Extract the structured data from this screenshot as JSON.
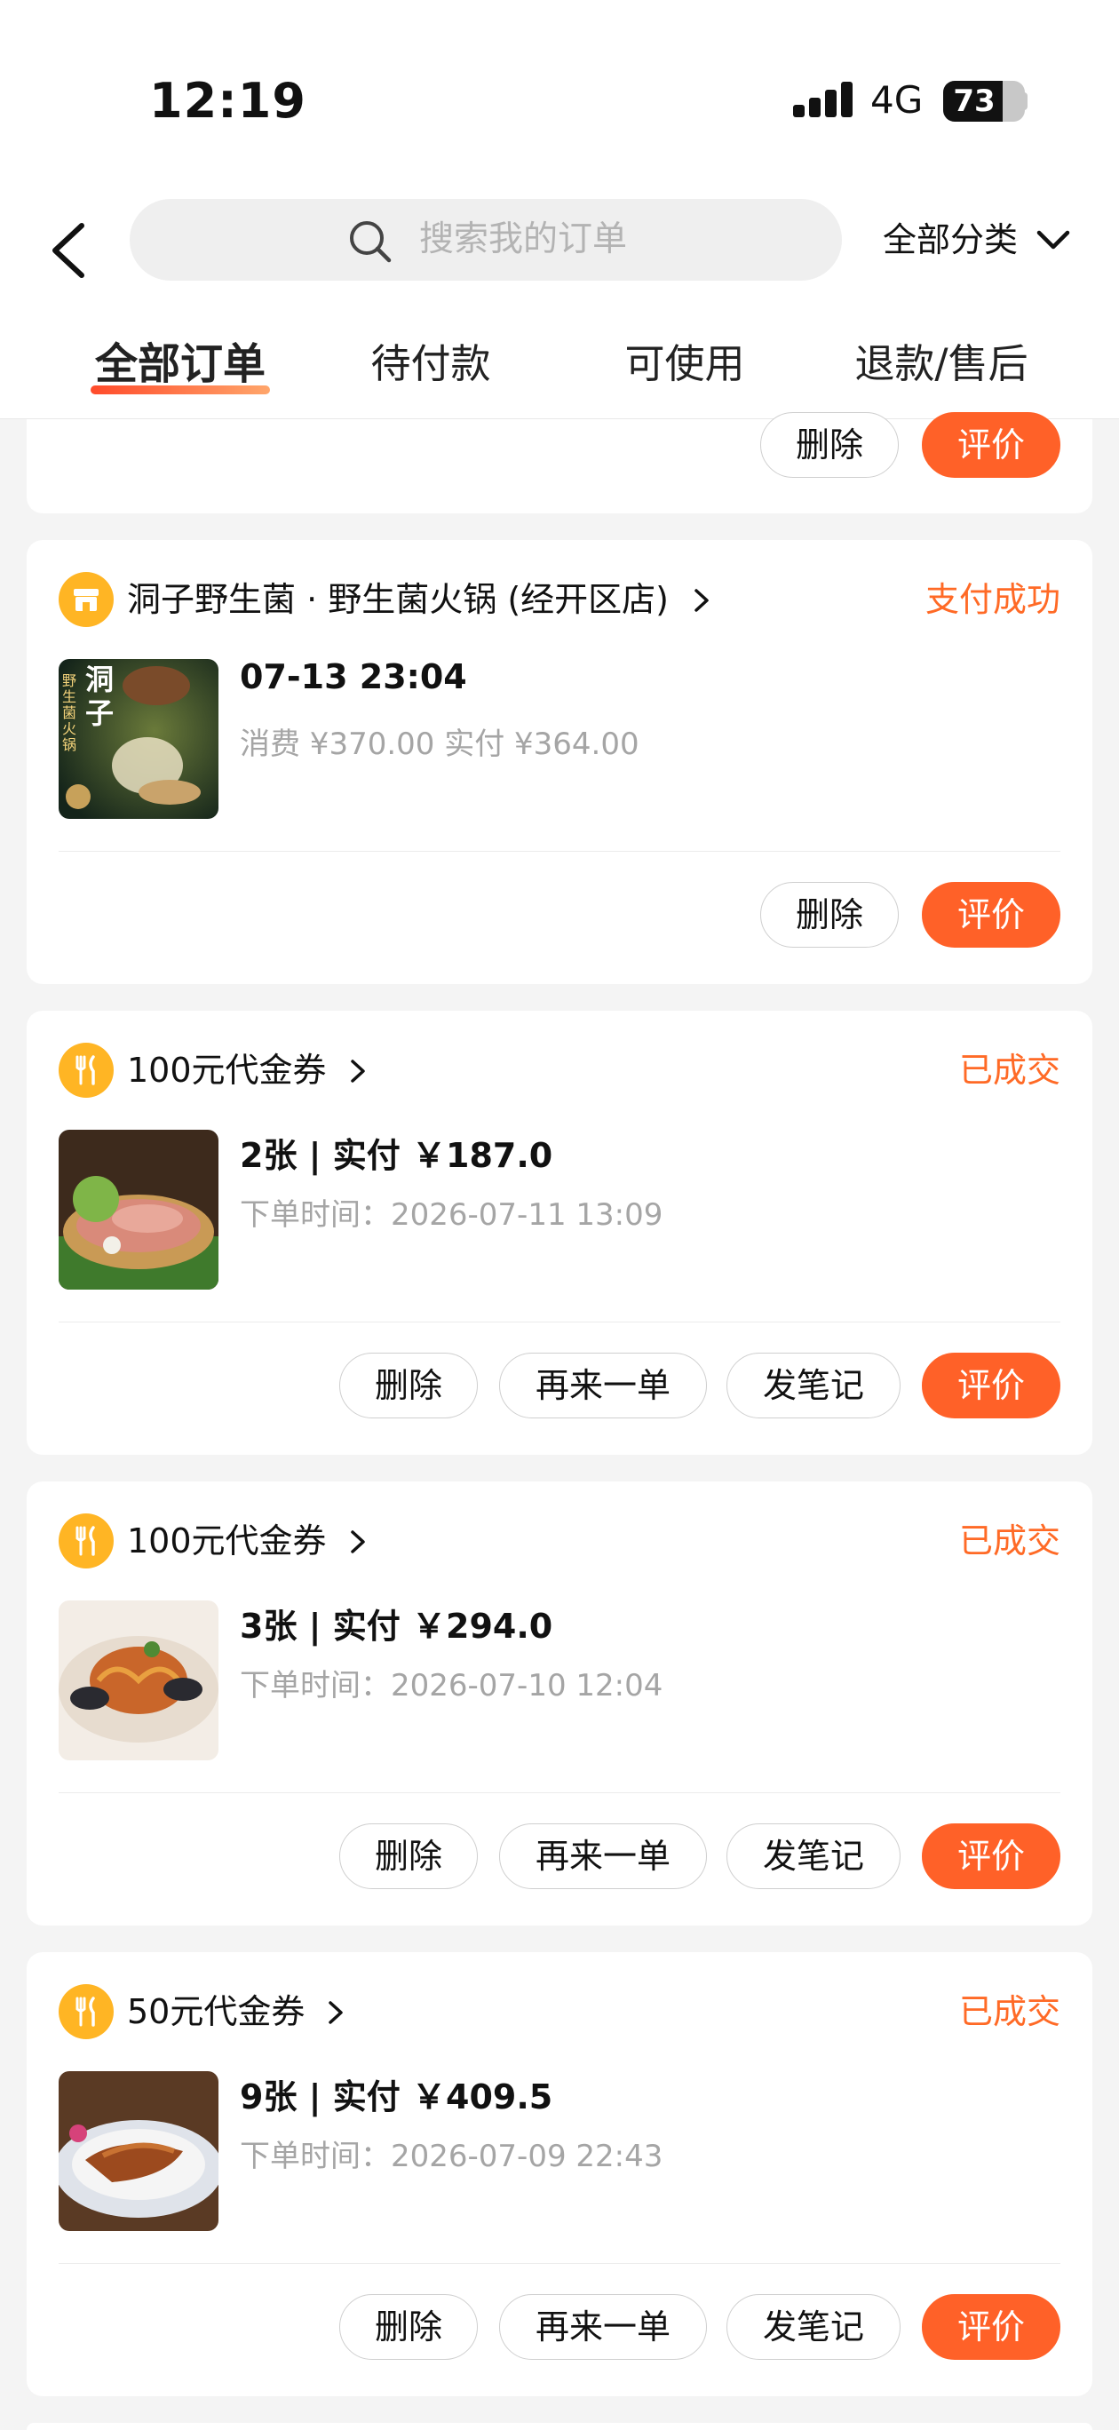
{
  "status_bar": {
    "time": "12:19",
    "network": "4G",
    "battery": "73",
    "battery_level": 0.73
  },
  "header": {
    "search_placeholder": "搜索我的订单",
    "category_label": "全部分类",
    "tabs": [
      {
        "label": "全部订单",
        "active": true
      },
      {
        "label": "待付款",
        "active": false
      },
      {
        "label": "可使用",
        "active": false
      },
      {
        "label": "退款/售后",
        "active": false
      }
    ]
  },
  "colors": {
    "accent": "#ff6128",
    "status": "#ff6a26",
    "shop_icon": "#ffb524"
  },
  "top_partial_card": {
    "buttons": [
      "删除",
      "评价"
    ]
  },
  "orders": [
    {
      "shop_icon": "store-icon",
      "shop": "洞子野生菌 · 野生菌火锅 (经开区店)",
      "status": "支付成功",
      "line1": "07-13 23:04",
      "line2": "消费 ¥370.00   实付 ¥364.00",
      "thumb_text": "洞子",
      "thumb_subtext": "野生菌火锅",
      "buttons": [
        "删除",
        "评价"
      ]
    },
    {
      "shop_icon": "utensils-icon",
      "shop": "100元代金券",
      "status": "已成交",
      "line1": "2张 | 实付 ￥187.0",
      "line2": "下单时间：2026-07-11 13:09",
      "buttons": [
        "删除",
        "再来一单",
        "发笔记",
        "评价"
      ]
    },
    {
      "shop_icon": "utensils-icon",
      "shop": "100元代金券",
      "status": "已成交",
      "line1": "3张 | 实付 ￥294.0",
      "line2": "下单时间：2026-07-10 12:04",
      "buttons": [
        "删除",
        "再来一单",
        "发笔记",
        "评价"
      ]
    },
    {
      "shop_icon": "utensils-icon",
      "shop": "50元代金券",
      "status": "已成交",
      "line1": "9张 | 实付 ￥409.5",
      "line2": "下单时间：2026-07-09 22:43",
      "buttons": [
        "删除",
        "再来一单",
        "发笔记",
        "评价"
      ]
    }
  ]
}
